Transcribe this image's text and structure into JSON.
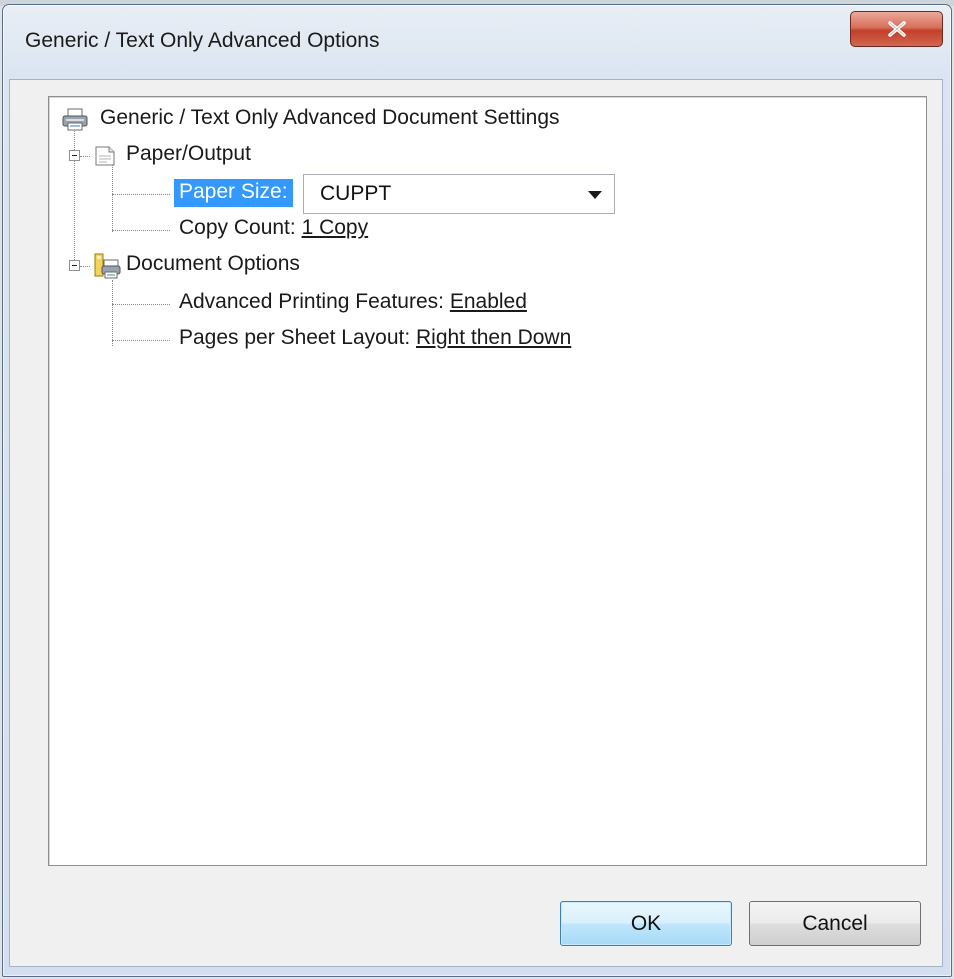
{
  "window": {
    "title": "Generic / Text Only Advanced Options",
    "close_glyph": "x"
  },
  "tree": {
    "root_label": "Generic / Text Only Advanced Document Settings",
    "paper_output": {
      "label": "Paper/Output",
      "paper_size_label": "Paper Size:",
      "paper_size_value": "CUPPT",
      "copy_count_label": "Copy Count:",
      "copy_count_value": "1 Copy"
    },
    "document_options": {
      "label": "Document Options",
      "advanced_printing_label": "Advanced Printing Features:",
      "advanced_printing_value": "Enabled",
      "pages_per_sheet_label": "Pages per Sheet Layout:",
      "pages_per_sheet_value": "Right then Down"
    }
  },
  "buttons": {
    "ok": "OK",
    "cancel": "Cancel"
  },
  "colors": {
    "selection": "#3399ff",
    "close_button": "#c8462f",
    "default_button_border": "#3c7fb1"
  },
  "icons": [
    "printer-icon",
    "paper-icon",
    "document-options-icon",
    "close-icon",
    "dropdown-arrow-icon"
  ]
}
